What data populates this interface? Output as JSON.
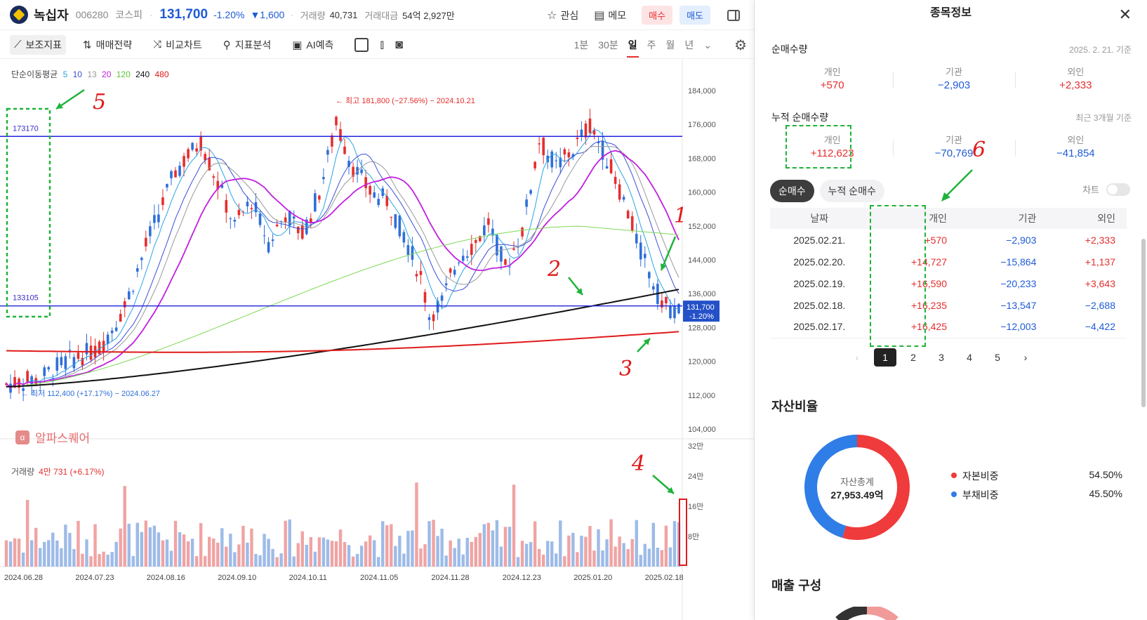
{
  "header": {
    "name": "녹십자",
    "code": "006280",
    "market": "코스피",
    "price": "131,700",
    "change_pct": "-1.20%",
    "change": "▼1,600",
    "volume_label": "거래량",
    "volume": "40,731",
    "amount_label": "거래대금",
    "amount": "54억 2,927만",
    "watch": "관심",
    "memo": "메모",
    "buy": "매수",
    "sell": "매도"
  },
  "toolbar": {
    "indicators": "보조지표",
    "strategy": "매매전략",
    "compare": "비교차트",
    "analysis": "지표분석",
    "ai": "AI예측",
    "periods": [
      "1분",
      "30분",
      "일",
      "주",
      "월",
      "년"
    ],
    "active_period": "일"
  },
  "chart": {
    "ma_title": "단순이동평균",
    "ma_periods": [
      {
        "label": "5",
        "color": "#29a3e6"
      },
      {
        "label": "10",
        "color": "#3a4fd8"
      },
      {
        "label": "13",
        "color": "#999999"
      },
      {
        "label": "20",
        "color": "#c020e0"
      },
      {
        "label": "120",
        "color": "#7ed957"
      },
      {
        "label": "240",
        "color": "#111111"
      },
      {
        "label": "480",
        "color": "#e01a1a"
      }
    ],
    "high_label": "← 최고 181,800 (−27.56%) − 2024.10.21",
    "low_label": "← 최저 112,400 (+17.17%) − 2024.06.27",
    "hline_top": "173170",
    "hline_bottom": "133105",
    "price_tag": "131,700",
    "price_tag_pct": "-1.20%",
    "y_ticks": [
      "184,000",
      "176,000",
      "168,000",
      "160,000",
      "152,000",
      "144,000",
      "136,000",
      "128,000",
      "120,000",
      "112,000",
      "104,000"
    ],
    "alpha_brand": "알파스퀘어",
    "alpha_icon": "α",
    "volume_title": "거래량",
    "volume_value": "4만 731 (+6.17%)",
    "vol_ticks": [
      "32만",
      "24만",
      "16만",
      "8만"
    ],
    "x_ticks": [
      "2024.06.28",
      "2024.07.23",
      "2024.08.16",
      "2024.09.10",
      "2024.10.11",
      "2024.11.05",
      "2024.11.28",
      "2024.12.23",
      "2025.01.20",
      "2025.02.18"
    ],
    "annotations": [
      "1",
      "2",
      "3",
      "4",
      "5",
      "6"
    ]
  },
  "panel": {
    "title": "종목정보",
    "net_title": "순매수량",
    "net_date": "2025. 2. 21. 기준",
    "net": [
      {
        "label": "개인",
        "value": "+570",
        "tone": "red"
      },
      {
        "label": "기관",
        "value": "−2,903",
        "tone": "blu"
      },
      {
        "label": "외인",
        "value": "+2,333",
        "tone": "red"
      }
    ],
    "cum_title": "누적 순매수량",
    "cum_date": "최근 3개월 기준",
    "cum": [
      {
        "label": "개인",
        "value": "+112,623",
        "tone": "red"
      },
      {
        "label": "기관",
        "value": "−70,769",
        "tone": "blu"
      },
      {
        "label": "외인",
        "value": "−41,854",
        "tone": "blu"
      }
    ],
    "seg_on": "순매수",
    "seg_off": "누적 순매수",
    "chart_toggle": "차트",
    "table_headers": [
      "날짜",
      "개인",
      "기관",
      "외인"
    ],
    "rows": [
      {
        "date": "2025.02.21.",
        "ind": "+570",
        "inst": "−2,903",
        "for": "+2,333"
      },
      {
        "date": "2025.02.20.",
        "ind": "+14,727",
        "inst": "−15,864",
        "for": "+1,137"
      },
      {
        "date": "2025.02.19.",
        "ind": "+16,590",
        "inst": "−20,233",
        "for": "+3,643"
      },
      {
        "date": "2025.02.18.",
        "ind": "+16,235",
        "inst": "−13,547",
        "for": "−2,688"
      },
      {
        "date": "2025.02.17.",
        "ind": "+16,425",
        "inst": "−12,003",
        "for": "−4,422"
      }
    ],
    "pages": [
      "1",
      "2",
      "3",
      "4",
      "5"
    ],
    "current_page": "1",
    "asset_title": "자산비율",
    "donut_center_label": "자산총계",
    "donut_center_value": "27,953.49억",
    "asset": [
      {
        "label": "자본비중",
        "value": "54.50%",
        "color": "#ef3b3b",
        "frac": 0.545
      },
      {
        "label": "부채비중",
        "value": "45.50%",
        "color": "#2f7de6",
        "frac": 0.455
      }
    ],
    "sales_title": "매출 구성"
  }
}
